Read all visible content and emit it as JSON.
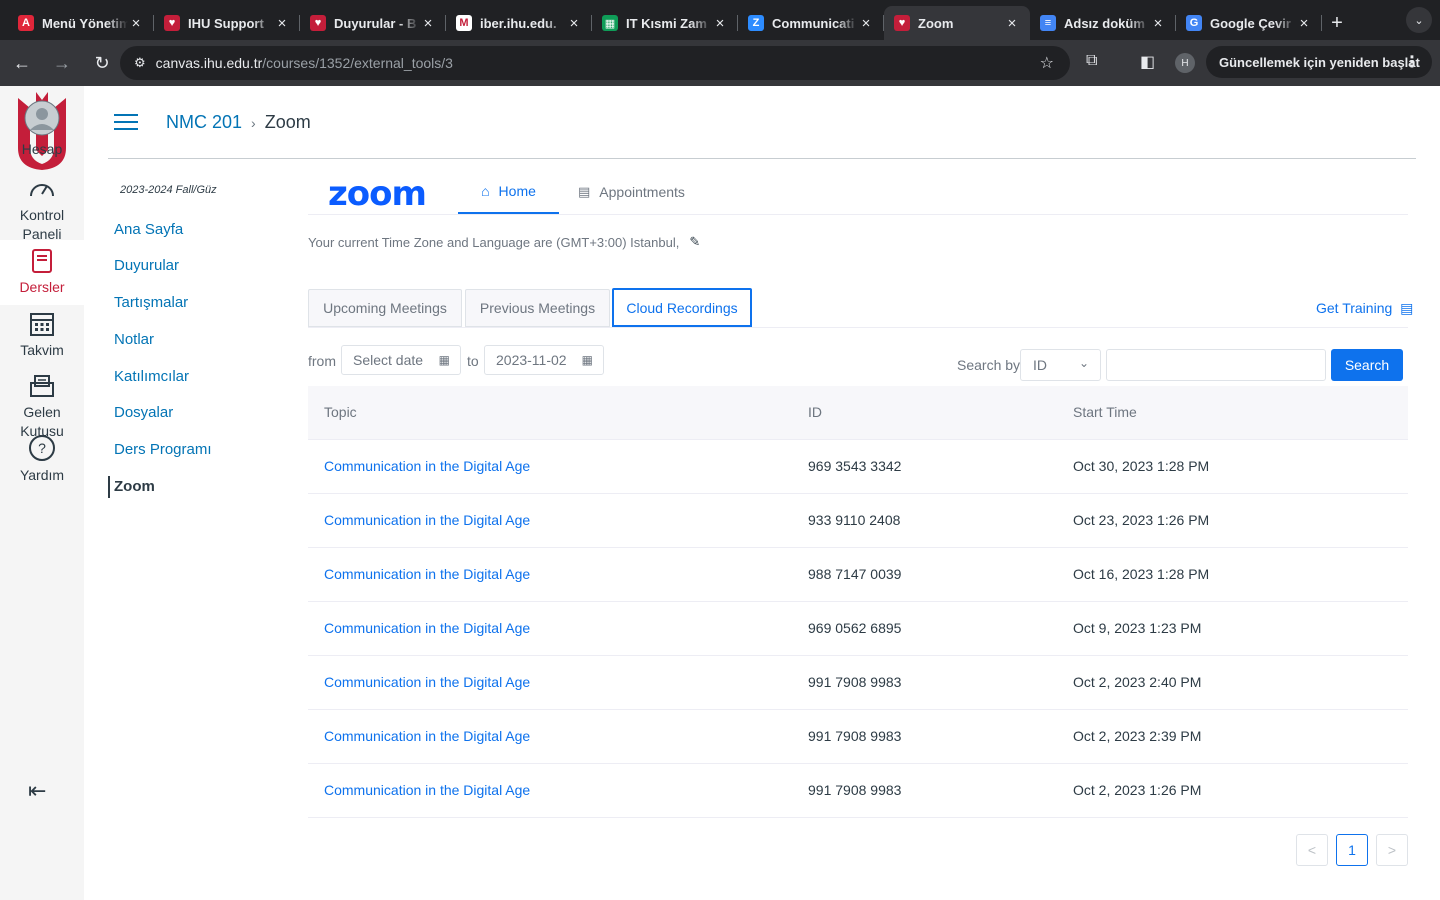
{
  "browser": {
    "tabs": [
      {
        "title": "Menü Yönetimi",
        "fav_color": "#e0263a",
        "fav_glyph": "A"
      },
      {
        "title": "IHU Support",
        "fav_color": "#c41e3a",
        "fav_glyph": "♥"
      },
      {
        "title": "Duyurular - B",
        "fav_color": "#c41e3a",
        "fav_glyph": "♥"
      },
      {
        "title": "iber.ihu.edu.",
        "fav_color": "#ffffff",
        "fav_glyph": "M"
      },
      {
        "title": "IT Kısmi Zam",
        "fav_color": "#0f9d58",
        "fav_glyph": "▦"
      },
      {
        "title": "Communicati",
        "fav_color": "#2d8cff",
        "fav_glyph": "Z"
      },
      {
        "title": "Zoom",
        "fav_color": "#c41e3a",
        "fav_glyph": "♥",
        "active": true
      },
      {
        "title": "Adsız doküm",
        "fav_color": "#4285f4",
        "fav_glyph": "≡"
      },
      {
        "title": "Google Çevir",
        "fav_color": "#4285f4",
        "fav_glyph": "G"
      }
    ],
    "url_host": "canvas.ihu.edu.tr",
    "url_path": "/courses/1352/external_tools/3",
    "profile_initial": "H",
    "update_label": "Güncellemek için yeniden başlat"
  },
  "global_nav": {
    "items": [
      {
        "label": "Hesap",
        "icon": "account-icon"
      },
      {
        "label": "Kontrol Paneli",
        "icon": "dashboard-icon"
      },
      {
        "label": "Dersler",
        "icon": "courses-icon",
        "active": true
      },
      {
        "label": "Takvim",
        "icon": "calendar-icon"
      },
      {
        "label": "Gelen Kutusu",
        "icon": "inbox-icon"
      },
      {
        "label": "Yardım",
        "icon": "help-icon"
      }
    ]
  },
  "breadcrumb": {
    "course": "NMC 201",
    "page": "Zoom"
  },
  "course_nav": {
    "term": "2023-2024 Fall/Güz",
    "items": [
      "Ana Sayfa",
      "Duyurular",
      "Tartışmalar",
      "Notlar",
      "Katılımcılar",
      "Dosyalar",
      "Ders Programı",
      "Zoom"
    ],
    "active": "Zoom"
  },
  "zoom": {
    "logo_text": "zoom",
    "tabs": {
      "home": "Home",
      "appointments": "Appointments"
    },
    "timezone_text": "Your current Time Zone and Language are (GMT+3:00) Istanbul,",
    "subtabs": {
      "upcoming": "Upcoming Meetings",
      "previous": "Previous Meetings",
      "cloud": "Cloud Recordings"
    },
    "get_training": "Get Training",
    "filters": {
      "from_label": "from",
      "from_placeholder": "Select date",
      "to_label": "to",
      "to_value": "2023-11-02",
      "search_by_label": "Search by",
      "search_by_value": "ID",
      "search_button": "Search"
    },
    "table": {
      "headers": {
        "topic": "Topic",
        "id": "ID",
        "start": "Start Time"
      },
      "rows": [
        {
          "topic": "Communication in the Digital Age",
          "id": "969 3543 3342",
          "start": "Oct 30, 2023 1:28 PM"
        },
        {
          "topic": "Communication in the Digital Age",
          "id": "933 9110 2408",
          "start": "Oct 23, 2023 1:26 PM"
        },
        {
          "topic": "Communication in the Digital Age",
          "id": "988 7147 0039",
          "start": "Oct 16, 2023 1:28 PM"
        },
        {
          "topic": "Communication in the Digital Age",
          "id": "969 0562 6895",
          "start": "Oct 9, 2023 1:23 PM"
        },
        {
          "topic": "Communication in the Digital Age",
          "id": "991 7908 9983",
          "start": "Oct 2, 2023 2:40 PM"
        },
        {
          "topic": "Communication in the Digital Age",
          "id": "991 7908 9983",
          "start": "Oct 2, 2023 2:39 PM"
        },
        {
          "topic": "Communication in the Digital Age",
          "id": "991 7908 9983",
          "start": "Oct 2, 2023 1:26 PM"
        }
      ]
    },
    "pagination": {
      "prev": "<",
      "current": "1",
      "next": ">"
    }
  }
}
